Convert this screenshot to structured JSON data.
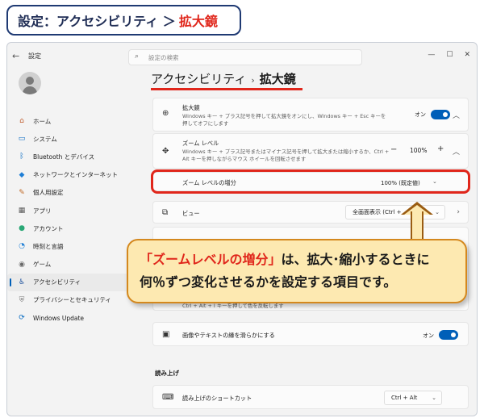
{
  "header": {
    "prefix": "設定：アクセシビリティ ＞",
    "highlight": "拡大鏡"
  },
  "window": {
    "back_icon": "back-arrow-icon",
    "title": "設定",
    "search_placeholder": "設定の検索",
    "controls": [
      "—",
      "☐",
      "✕"
    ]
  },
  "sidebar": {
    "items": [
      {
        "label": "ホーム",
        "icon": "home-icon",
        "glyph": "⌂",
        "color": "#c05a2b"
      },
      {
        "label": "システム",
        "icon": "system-icon",
        "glyph": "▭",
        "color": "#0067c0"
      },
      {
        "label": "Bluetooth とデバイス",
        "icon": "bluetooth-icon",
        "glyph": "ᛒ",
        "color": "#0067c0"
      },
      {
        "label": "ネットワークとインターネット",
        "icon": "network-icon",
        "glyph": "◆",
        "color": "#1f7fd6"
      },
      {
        "label": "個人用設定",
        "icon": "brush-icon",
        "glyph": "✎",
        "color": "#c06a26"
      },
      {
        "label": "アプリ",
        "icon": "apps-icon",
        "glyph": "▦",
        "color": "#5a5a5a"
      },
      {
        "label": "アカウント",
        "icon": "account-icon",
        "glyph": "●",
        "color": "#2aa876"
      },
      {
        "label": "時刻と言語",
        "icon": "time-language-icon",
        "glyph": "◔",
        "color": "#1f7fd6"
      },
      {
        "label": "ゲーム",
        "icon": "game-icon",
        "glyph": "◉",
        "color": "#6a6a6a"
      },
      {
        "label": "アクセシビリティ",
        "icon": "accessibility-icon",
        "glyph": "♿",
        "color": "#1a4f9c"
      },
      {
        "label": "プライバシーとセキュリティ",
        "icon": "shield-icon",
        "glyph": "⛨",
        "color": "#7a7a7a"
      },
      {
        "label": "Windows Update",
        "icon": "update-icon",
        "glyph": "⟳",
        "color": "#0067c0"
      }
    ],
    "active_index": 9
  },
  "breadcrumb": {
    "parent": "アクセシビリティ",
    "separator": "›",
    "current": "拡大鏡"
  },
  "magnifier": {
    "title": "拡大鏡",
    "desc": "Windows キー + プラス記号を押して拡大鏡をオンにし、Windows キー + Esc キーを押してオフにします",
    "toggle_label": "オン",
    "toggle_on": true
  },
  "zoom": {
    "title": "ズーム レベル",
    "desc": "Windows キー + プラス記号またはマイナス記号を押して拡大または縮小するか、Ctrl + Alt キーを押しながらマウス ホイールを回転させます",
    "minus": "−",
    "value": "100%",
    "plus": "+"
  },
  "increment": {
    "label": "ズーム レベルの増分",
    "value": "100% (既定値)"
  },
  "view": {
    "label": "ビュー",
    "value": "全画面表示 (Ctrl +"
  },
  "hidden_row": {
    "desc": "Ctrl + Alt + I キーを押して色を反転します"
  },
  "smooth": {
    "label": "画像やテキストの縁を滑らかにする",
    "toggle_label": "オン",
    "toggle_on": true
  },
  "reading": {
    "section_title": "読み上げ",
    "shortcut_label": "読み上げのショートカット",
    "shortcut_value": "Ctrl + Alt"
  },
  "callout": {
    "quote": "「ズームレベルの増分」",
    "line1_rest": "は、拡大･縮小するときに",
    "line2": "何％ずつ変化させるかを設定する項目です。"
  },
  "colors": {
    "accent": "#005fb8",
    "highlight_red": "#e0261b",
    "callout_bg": "#fde9b1"
  }
}
